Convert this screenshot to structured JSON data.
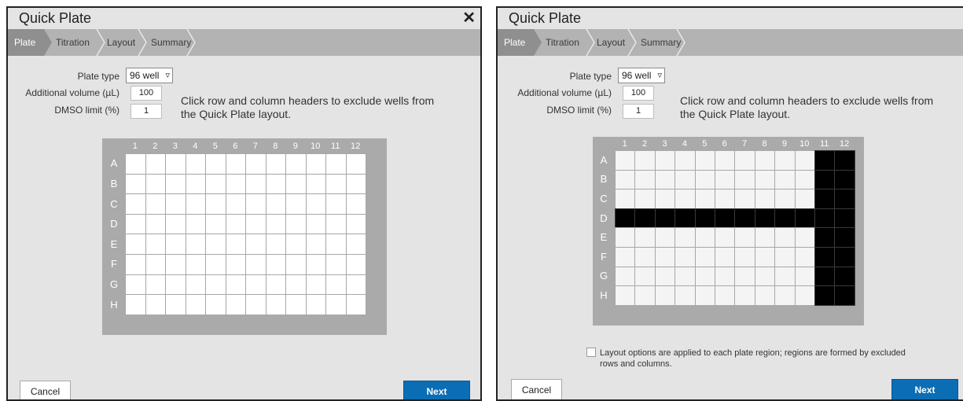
{
  "dialogs": [
    {
      "title": "Quick Plate",
      "close_icon": "✕",
      "tabs": [
        "Plate",
        "Titration",
        "Layout",
        "Summary"
      ],
      "plate_type_label": "Plate type",
      "plate_type_value": "96 well",
      "additional_volume_label": "Additional volume (µL)",
      "additional_volume_value": "100",
      "dmso_label": "DMSO limit (%)",
      "dmso_value": "1",
      "hint": "Click row and column headers to exclude wells from the Quick Plate layout.",
      "columns": [
        "1",
        "2",
        "3",
        "4",
        "5",
        "6",
        "7",
        "8",
        "9",
        "10",
        "11",
        "12"
      ],
      "rows": [
        "A",
        "B",
        "C",
        "D",
        "E",
        "F",
        "G",
        "H"
      ],
      "excluded_rows": [],
      "excluded_columns": [],
      "well_color": "#ffffff",
      "cancel_label": "Cancel",
      "next_label": "Next"
    },
    {
      "title": "Quick Plate",
      "close_icon": "✕",
      "tabs": [
        "Plate",
        "Titration",
        "Layout",
        "Summary"
      ],
      "plate_type_label": "Plate type",
      "plate_type_value": "96 well",
      "additional_volume_label": "Additional volume (µL)",
      "additional_volume_value": "100",
      "dmso_label": "DMSO limit (%)",
      "dmso_value": "1",
      "hint": "Click row and column headers to exclude wells from the Quick Plate layout.",
      "columns": [
        "1",
        "2",
        "3",
        "4",
        "5",
        "6",
        "7",
        "8",
        "9",
        "10",
        "11",
        "12"
      ],
      "rows": [
        "A",
        "B",
        "C",
        "D",
        "E",
        "F",
        "G",
        "H"
      ],
      "excluded_rows": [
        "D"
      ],
      "excluded_columns": [
        "11",
        "12"
      ],
      "well_color": "#f4f4f4",
      "option_note": "Layout options are applied to each plate region; regions are formed by excluded rows and columns.",
      "cancel_label": "Cancel",
      "next_label": "Next"
    }
  ],
  "colors": {
    "accent": "#0b6db4",
    "excluded": "#000000",
    "plate_frame": "#aaaaaa",
    "active_tab": "#8f8f8f"
  }
}
